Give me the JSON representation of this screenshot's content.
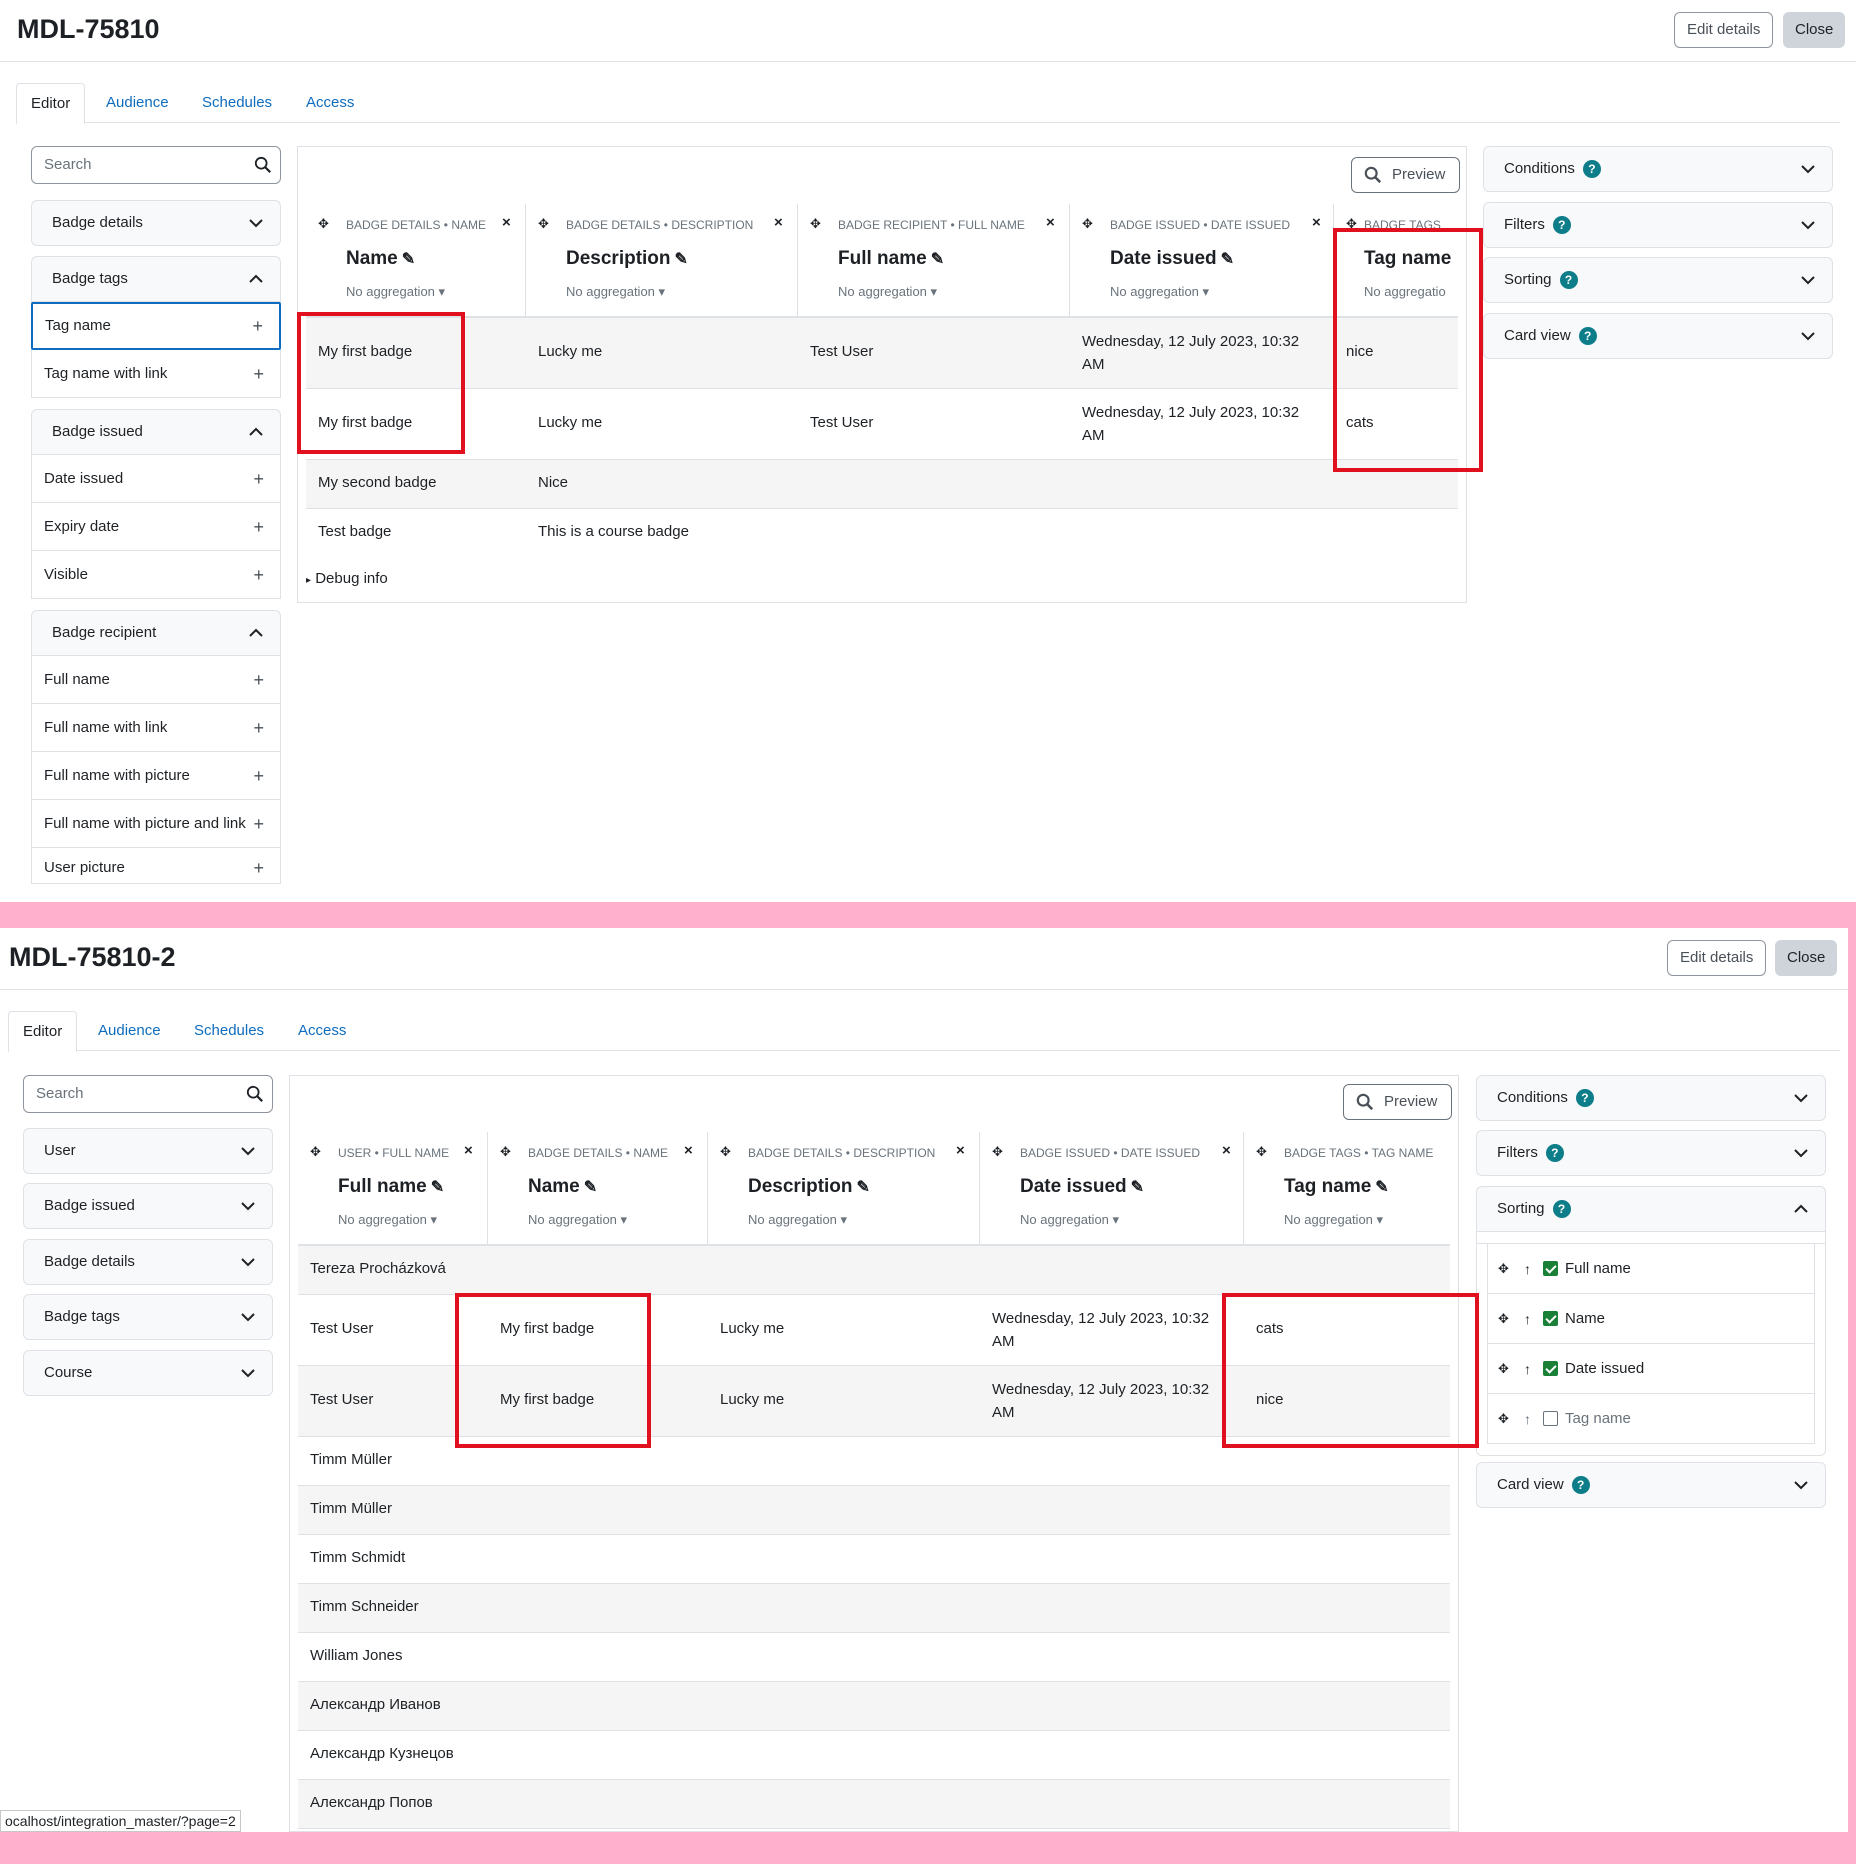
{
  "colors": {
    "accent": "#0f6cbf",
    "highlight": "#e0101e",
    "separator": "#ffb0cc",
    "help": "#0d7d8a"
  },
  "top": {
    "title": "MDL-75810",
    "edit_label": "Edit details",
    "close_label": "Close",
    "tabs": [
      "Editor",
      "Audience",
      "Schedules",
      "Access"
    ],
    "search_placeholder": "Search",
    "sidebar": {
      "badge_details": "Badge details",
      "badge_tags": "Badge tags",
      "tag_items": [
        "Tag name",
        "Tag name with link"
      ],
      "badge_issued": "Badge issued",
      "issued_items": [
        "Date issued",
        "Expiry date",
        "Visible"
      ],
      "badge_recipient": "Badge recipient",
      "recipient_items": [
        "Full name",
        "Full name with link",
        "Full name with picture",
        "Full name with picture and link",
        "User picture"
      ]
    },
    "preview_label": "Preview",
    "columns": [
      {
        "uniq": "Badge details • Name",
        "title": "Name",
        "agg": "No aggregation"
      },
      {
        "uniq": "Badge details • Description",
        "title": "Description",
        "agg": "No aggregation"
      },
      {
        "uniq": "Badge recipient • Full name",
        "title": "Full name",
        "agg": "No aggregation"
      },
      {
        "uniq": "Badge issued • Date issued",
        "title": "Date issued",
        "agg": "No aggregation"
      },
      {
        "uniq": "Badge tags",
        "title": "Tag name",
        "agg": "No aggregatio"
      }
    ],
    "rows": [
      [
        "My first badge",
        "Lucky me",
        "Test User",
        "Wednesday, 12 July 2023, 10:32 AM",
        "nice"
      ],
      [
        "My first badge",
        "Lucky me",
        "Test User",
        "Wednesday, 12 July 2023, 10:32 AM",
        "cats"
      ],
      [
        "My second badge",
        "Nice",
        "",
        "",
        ""
      ],
      [
        "Test badge",
        "This is a course badge",
        "",
        "",
        ""
      ]
    ],
    "debug_label": "Debug info",
    "right": {
      "conditions": "Conditions",
      "filters": "Filters",
      "sorting": "Sorting",
      "card_view": "Card view",
      "help": "?"
    }
  },
  "bottom": {
    "title": "MDL-75810-2",
    "edit_label": "Edit details",
    "close_label": "Close",
    "tabs": [
      "Editor",
      "Audience",
      "Schedules",
      "Access"
    ],
    "search_placeholder": "Search",
    "sidebar": [
      "User",
      "Badge issued",
      "Badge details",
      "Badge tags",
      "Course"
    ],
    "preview_label": "Preview",
    "columns": [
      {
        "uniq": "User • Full name",
        "title": "Full name",
        "agg": "No aggregation"
      },
      {
        "uniq": "Badge details • Name",
        "title": "Name",
        "agg": "No aggregation"
      },
      {
        "uniq": "Badge details • Description",
        "title": "Description",
        "agg": "No aggregation"
      },
      {
        "uniq": "Badge issued • Date issued",
        "title": "Date issued",
        "agg": "No aggregation"
      },
      {
        "uniq": "Badge tags • Tag name",
        "title": "Tag name",
        "agg": "No aggregation"
      }
    ],
    "rows": [
      [
        "Tereza Procházková",
        "",
        "",
        "",
        ""
      ],
      [
        "Test User",
        "My first badge",
        "Lucky me",
        "Wednesday, 12 July 2023, 10:32 AM",
        "cats"
      ],
      [
        "Test User",
        "My first badge",
        "Lucky me",
        "Wednesday, 12 July 2023, 10:32 AM",
        "nice"
      ],
      [
        "Timm Müller",
        "",
        "",
        "",
        ""
      ],
      [
        "Timm Müller",
        "",
        "",
        "",
        ""
      ],
      [
        "Timm Schmidt",
        "",
        "",
        "",
        ""
      ],
      [
        "Timm Schneider",
        "",
        "",
        "",
        ""
      ],
      [
        "William Jones",
        "",
        "",
        "",
        ""
      ],
      [
        "Александр Иванов",
        "",
        "",
        "",
        ""
      ],
      [
        "Александр Кузнецов",
        "",
        "",
        "",
        ""
      ],
      [
        "Александр Попов",
        "",
        "",
        "",
        ""
      ]
    ],
    "right": {
      "conditions": "Conditions",
      "filters": "Filters",
      "sorting": "Sorting",
      "card_view": "Card view",
      "help": "?"
    },
    "sort_items": [
      {
        "label": "Full name",
        "checked": true
      },
      {
        "label": "Name",
        "checked": true
      },
      {
        "label": "Date issued",
        "checked": true
      },
      {
        "label": "Tag name",
        "checked": false
      }
    ]
  },
  "status_url": "ocalhost/integration_master/?page=2"
}
